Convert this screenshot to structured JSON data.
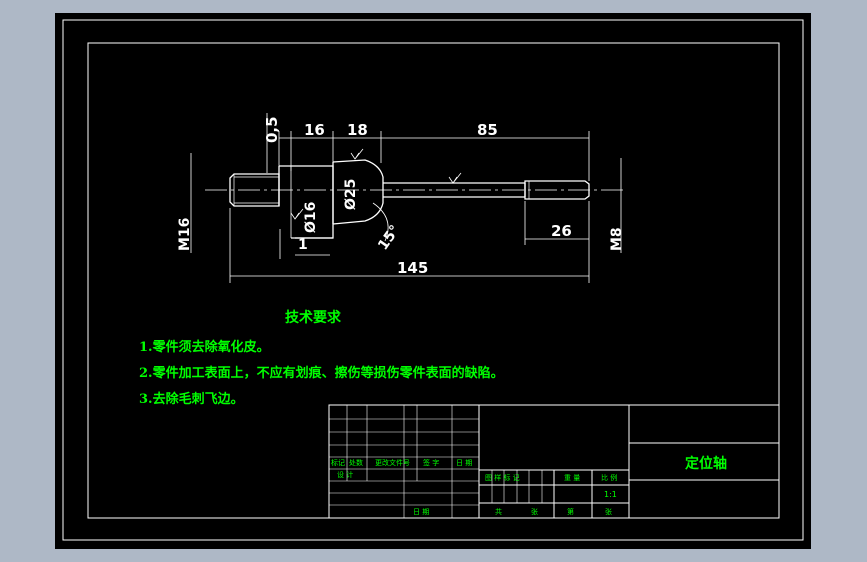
{
  "dimensions": {
    "d_0_5": "0,5",
    "d_16": "16",
    "d_18": "18",
    "d_85": "85",
    "d_145": "145",
    "d_26": "26",
    "d_M16": "M16",
    "d_M8": "M8",
    "d_phi25": "Ø25",
    "d_phi16": "Ø16",
    "d_1": "1",
    "d_15deg": "15°"
  },
  "requirements": {
    "title": "技术要求",
    "items": [
      "1.零件须去除氧化皮。",
      "2.零件加工表面上，不应有划痕、擦伤等损伤零件表面的缺陷。",
      "3.去除毛刺飞边。"
    ]
  },
  "title_block": {
    "part_name": "定位轴",
    "scale_value": "1:1",
    "rev_headers": [
      "标记",
      "处数",
      "更改文件号",
      "签 字",
      "日 期"
    ],
    "design_label": "设 计",
    "date_label": "日 期",
    "stage_headers": [
      "图 样 标 记",
      "重 量",
      "比 例"
    ],
    "sheet_total": "共",
    "sheet_unit_1": "张",
    "sheet_no": "第",
    "sheet_unit_2": "张"
  },
  "colors": {
    "background": "#000000",
    "outline": "#ffffff",
    "annotation": "#00ff00",
    "surround": "#aeb8c6"
  }
}
